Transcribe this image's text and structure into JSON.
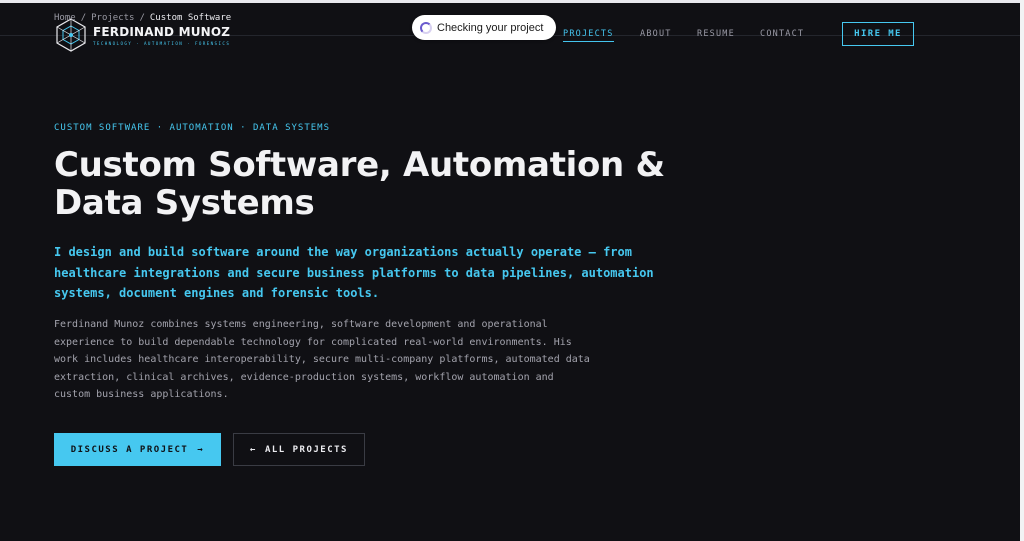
{
  "breadcrumb": {
    "home": "Home",
    "separator": "/",
    "projects": "Projects",
    "current": "Custom Software"
  },
  "brand": {
    "name": "FERDINAND MUNOZ",
    "tagline": "TECHNOLOGY · AUTOMATION · FORENSICS"
  },
  "status_pill": {
    "text": "Checking your project"
  },
  "nav": {
    "items": [
      {
        "label": "PROJECTS",
        "active": true
      },
      {
        "label": "ABOUT",
        "active": false
      },
      {
        "label": "RESUME",
        "active": false
      },
      {
        "label": "CONTACT",
        "active": false
      }
    ],
    "cta": "HIRE ME"
  },
  "hero": {
    "eyebrow": "CUSTOM SOFTWARE · AUTOMATION · DATA SYSTEMS",
    "title_line1": "Custom Software, Automation &",
    "title_line2": "Data Systems",
    "lead": "I design and build software around the way organizations actually operate — from healthcare integrations and secure business platforms to data pipelines, automation systems, document engines and forensic tools.",
    "description": "Ferdinand Munoz combines systems engineering, software development and operational experience to build dependable technology for complicated real-world environments. His work includes healthcare interoperability, secure multi-company platforms, automated data extraction, clinical archives, evidence-production systems, workflow automation and custom business applications.",
    "primary_button": "DISCUSS A PROJECT",
    "primary_arrow": "→",
    "secondary_button": "ALL PROJECTS",
    "secondary_arrow": "←"
  },
  "colors": {
    "accent": "#46c8f0",
    "background": "#101014",
    "text": "#f2f2f4",
    "muted": "#a3a3ad"
  },
  "icons": {
    "logo": "geometric-cube-logo-icon",
    "spinner": "loading-spinner-icon",
    "arrow_right": "arrow-right-icon",
    "arrow_left": "arrow-left-icon"
  }
}
